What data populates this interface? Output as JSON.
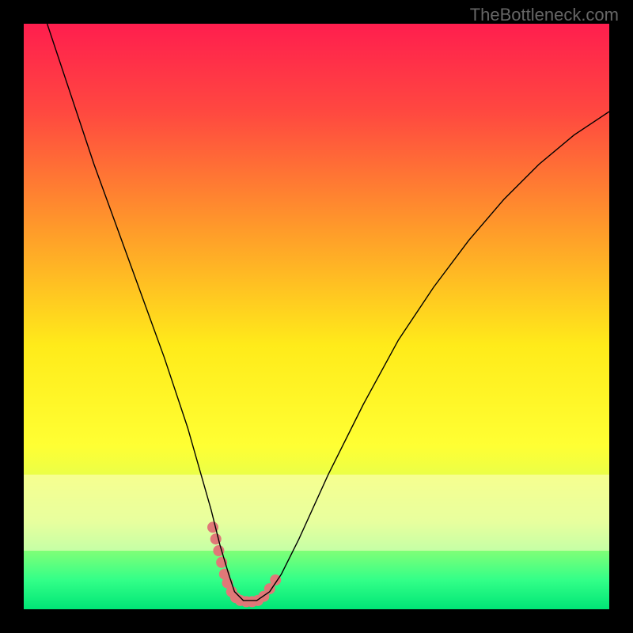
{
  "attribution": "TheBottleneck.com",
  "chart_data": {
    "type": "line",
    "title": "",
    "xlabel": "",
    "ylabel": "",
    "xlim": [
      0,
      100
    ],
    "ylim": [
      0,
      100
    ],
    "background_gradient": {
      "stops": [
        {
          "offset": 0.0,
          "color": "#ff1e4e"
        },
        {
          "offset": 0.15,
          "color": "#ff4840"
        },
        {
          "offset": 0.35,
          "color": "#ff9a2a"
        },
        {
          "offset": 0.55,
          "color": "#ffeb1a"
        },
        {
          "offset": 0.72,
          "color": "#ffff33"
        },
        {
          "offset": 0.85,
          "color": "#ccff66"
        },
        {
          "offset": 0.95,
          "color": "#33ff88"
        },
        {
          "offset": 1.0,
          "color": "#00e676"
        }
      ],
      "pale_band": {
        "y_start": 0.77,
        "y_end": 0.9,
        "color": "#ffffcc"
      }
    },
    "series": [
      {
        "name": "bottleneck-curve",
        "type": "line",
        "color": "#000000",
        "width": 1.4,
        "x": [
          4,
          8,
          12,
          16,
          20,
          24,
          28,
          30,
          32,
          33.5,
          35,
          36,
          37.5,
          39.8,
          42,
          44,
          47,
          52,
          58,
          64,
          70,
          76,
          82,
          88,
          94,
          100
        ],
        "y": [
          100,
          88,
          76,
          65,
          54,
          43,
          31,
          24,
          17,
          11,
          6,
          3,
          1.5,
          1.5,
          3,
          6,
          12,
          23,
          35,
          46,
          55,
          63,
          70,
          76,
          81,
          85
        ]
      }
    ],
    "marker_overlay": {
      "color": "#e07878",
      "radius": 7,
      "points": [
        {
          "x": 32.3,
          "y": 14.0
        },
        {
          "x": 32.8,
          "y": 12.0
        },
        {
          "x": 33.3,
          "y": 10.0
        },
        {
          "x": 33.8,
          "y": 8.0
        },
        {
          "x": 34.3,
          "y": 6.0
        },
        {
          "x": 34.8,
          "y": 4.5
        },
        {
          "x": 35.5,
          "y": 3.0
        },
        {
          "x": 36.2,
          "y": 2.0
        },
        {
          "x": 37.0,
          "y": 1.5
        },
        {
          "x": 38.0,
          "y": 1.3
        },
        {
          "x": 39.0,
          "y": 1.3
        },
        {
          "x": 40.0,
          "y": 1.5
        },
        {
          "x": 41.0,
          "y": 2.2
        },
        {
          "x": 42.0,
          "y": 3.5
        },
        {
          "x": 43.0,
          "y": 5.0
        }
      ]
    }
  }
}
